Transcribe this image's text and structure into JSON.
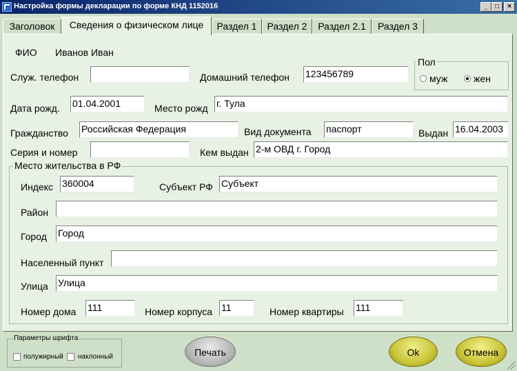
{
  "window": {
    "title": "Настройка формы декларации по форме КНД 1152016",
    "controls": {
      "minimize": "_",
      "maximize": "□",
      "close": "×"
    }
  },
  "tabs": [
    {
      "label": "Заголовок"
    },
    {
      "label": "Сведения о физическом лице"
    },
    {
      "label": "Раздел 1"
    },
    {
      "label": "Раздел 2"
    },
    {
      "label": "Раздел 2.1"
    },
    {
      "label": "Раздел 3"
    }
  ],
  "person": {
    "fio_label": "ФИО",
    "fio_value": "Иванов Иван",
    "work_phone_label": "Служ. телефон",
    "work_phone_value": "",
    "home_phone_label": "Домашний телефон",
    "home_phone_value": "123456789",
    "gender": {
      "legend": "Пол",
      "male_label": "муж",
      "female_label": "жен",
      "selected": "жен"
    },
    "birth_date_label": "Дата рожд.",
    "birth_date_value": "01.04.2001",
    "birth_place_label": "Место рожд",
    "birth_place_value": "г. Тула",
    "citizenship_label": "Гражданство",
    "citizenship_value": "Российская Федерация",
    "doc_type_label": "Вид документа",
    "doc_type_value": "паспорт",
    "issued_label": "Выдан",
    "issued_value": "16.04.2003",
    "series_label": "Серия и номер",
    "series_value": "",
    "issued_by_label": "Кем выдан",
    "issued_by_value": "2-м ОВД г. Город"
  },
  "residence": {
    "legend": "Место жительства в РФ",
    "index_label": "Индекс",
    "index_value": "360004",
    "subject_label": "Субъект РФ",
    "subject_value": "Субъект",
    "district_label": "Район",
    "district_value": "",
    "city_label": "Город",
    "city_value": "Город",
    "settlement_label": "Населенный пункт",
    "settlement_value": "",
    "street_label": "Улица",
    "street_value": "Улица",
    "house_label": "Номер дома",
    "house_value": "111",
    "building_label": "Номер корпуса",
    "building_value": "11",
    "apartment_label": "Номер квартиры",
    "apartment_value": "111"
  },
  "font_params": {
    "legend": "Параметры шрифта",
    "bold_label": "полужирный",
    "italic_label": "наклонный"
  },
  "buttons": {
    "print": "Печать",
    "ok": "Ok",
    "cancel": "Отмена"
  }
}
